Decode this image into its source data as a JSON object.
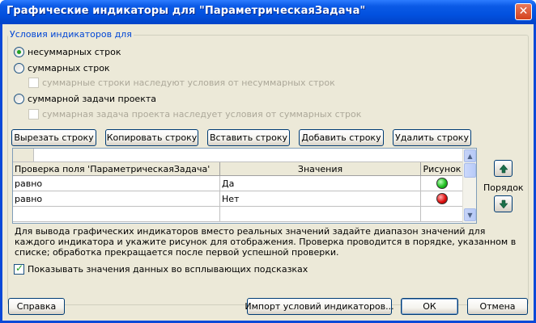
{
  "window": {
    "title": "Графические индикаторы для \"ПараметрическаяЗадача\""
  },
  "group": {
    "legend": "Условия индикаторов для",
    "radios": [
      {
        "label": "несуммарных строк",
        "checked": true
      },
      {
        "label": "суммарных строк",
        "checked": false
      },
      {
        "label": "суммарной задачи проекта",
        "checked": false
      }
    ],
    "sub_checks": [
      "суммарные строки наследуют условия от несуммарных строк",
      "суммарная задача проекта наследует условия от суммарных строк"
    ]
  },
  "toolbar": {
    "cut": "Вырезать строку",
    "copy": "Копировать строку",
    "paste": "Вставить строку",
    "add": "Добавить строку",
    "delete": "Удалить строку"
  },
  "grid": {
    "headers": [
      "Проверка поля 'ПараметрическаяЗадача'",
      "Значения",
      "Рисунок"
    ],
    "rows": [
      {
        "test": "равно",
        "value": "Да",
        "icon": "green-circle-icon",
        "color": "#22c022"
      },
      {
        "test": "равно",
        "value": "Нет",
        "icon": "red-circle-icon",
        "color": "#e01010"
      }
    ]
  },
  "order_label": "Порядок",
  "help_text": "Для вывода графических индикаторов вместо реальных значений задайте диапазон значений для каждого индикатора и укажите рисунок для отображения.  Проверка проводится в порядке, указанном в списке; обработка прекращается после первой успешной проверки.",
  "tooltip_check": "Показывать значения данных во всплывающих подсказках",
  "buttons": {
    "help": "Справка",
    "import": "Импорт условий индикаторов...",
    "ok": "ОК",
    "cancel": "Отмена"
  }
}
